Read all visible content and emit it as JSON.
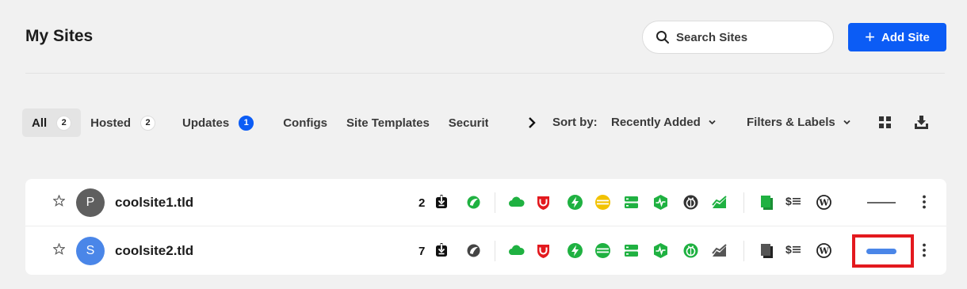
{
  "header": {
    "title": "My Sites"
  },
  "search": {
    "placeholder": "Search Sites"
  },
  "add_site": {
    "label": "Add Site"
  },
  "tabs": [
    {
      "label": "All",
      "count": "2"
    },
    {
      "label": "Hosted",
      "count": "2"
    },
    {
      "label": "Updates",
      "count": "1"
    },
    {
      "label": "Configs"
    },
    {
      "label": "Site Templates"
    },
    {
      "label": "Security"
    }
  ],
  "sort": {
    "label": "Sort by:",
    "value": "Recently Added"
  },
  "filters": {
    "label": "Filters & Labels"
  },
  "sites": [
    {
      "initial": "P",
      "name": "coolsite1.tld",
      "updates": "2",
      "avatar_color": "#5f5f5f"
    },
    {
      "initial": "S",
      "name": "coolsite2.tld",
      "updates": "7",
      "avatar_color": "#4a86e8"
    }
  ],
  "colors": {
    "accent": "#0b5cf5",
    "status_green": "#1fb141",
    "status_yellow": "#f2c200",
    "alert_red": "#e3191e"
  },
  "icons": [
    "search-icon",
    "plus-icon",
    "grid-view-icon",
    "download-icon",
    "star-icon",
    "update-icon",
    "leaf-icon",
    "cloud-icon",
    "shield-icon",
    "bolt-icon",
    "database-icon",
    "server-icon",
    "uptime-icon",
    "bug-icon",
    "analytics-icon",
    "document-icon",
    "dollar-icon",
    "wordpress-icon",
    "more-vertical-icon"
  ]
}
